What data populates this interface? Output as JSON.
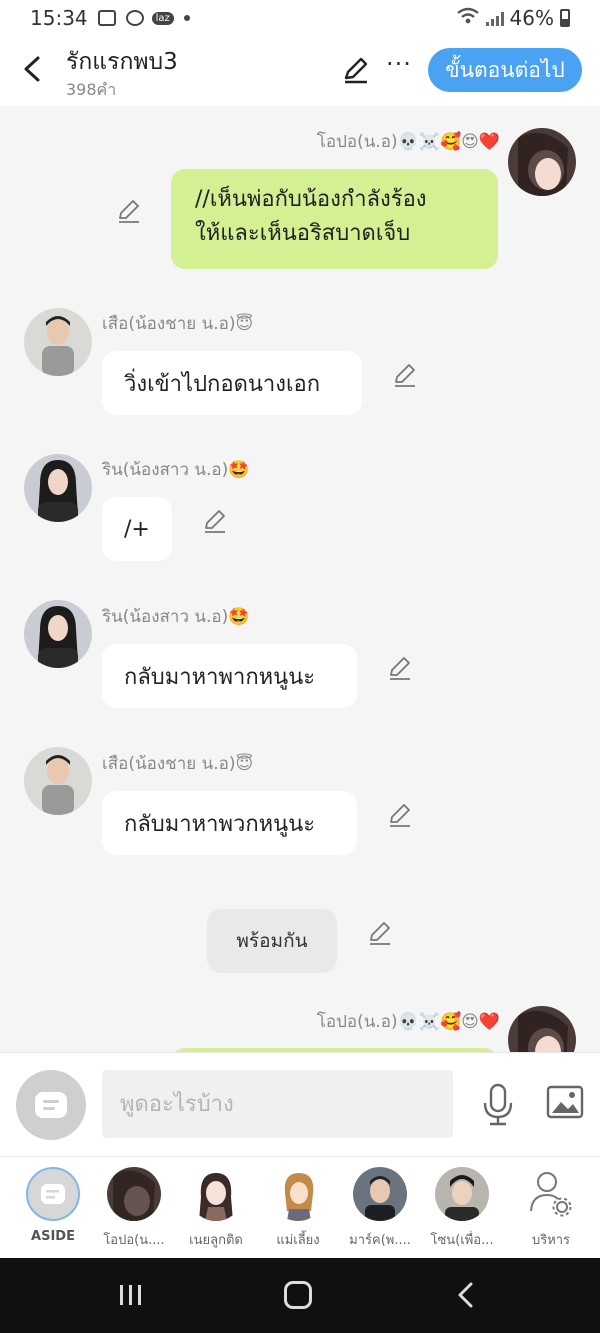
{
  "status": {
    "time": "15:34",
    "battery": "46%",
    "notification_icons": [
      "gallery-icon",
      "screen-record-icon",
      "lazada-icon"
    ],
    "laz_label": "laz"
  },
  "header": {
    "title": "รักแรกพบ3",
    "subtitle": "398คำ",
    "more": "···",
    "next_button": "ขั้นตอนต่อไป"
  },
  "messages": [
    {
      "speaker": "โอปอ(น.อ)💀☠️🥰😍❤️",
      "text": "//เห็นพ่อกับน้องกำลังร้องให้และเห็นอริสบาดเจ็บ",
      "line1": "//เห็นพ่อกับน้องกำลังร้อง",
      "line2": "ให้และเห็นอริสบาดเจ็บ",
      "side": "right"
    },
    {
      "speaker": "เสือ(น้องชาย น.อ)😇",
      "text": "วิ่งเข้าไปกอดนางเอก",
      "side": "left"
    },
    {
      "speaker": "ริน(น้องสาว น.อ)🤩",
      "text": "/+",
      "side": "left"
    },
    {
      "speaker": "ริน(น้องสาว น.อ)🤩",
      "text": "กลับมาหาพากหนูนะ",
      "side": "left"
    },
    {
      "speaker": "เสือ(น้องชาย น.อ)😇",
      "text": "กลับมาหาพวกหนูนะ",
      "side": "left"
    },
    {
      "speaker": "",
      "text": "พร้อมกัน",
      "side": "center"
    },
    {
      "speaker": "โอปอ(น.อ)💀☠️🥰😍❤️",
      "text": "",
      "side": "right"
    }
  ],
  "input": {
    "placeholder": "พูดอะไรบ้าง"
  },
  "characters": [
    {
      "label": "ASIDE"
    },
    {
      "label": "โอปอ(น...."
    },
    {
      "label": "เนยลูกติด"
    },
    {
      "label": "แม่เลี้ยง"
    },
    {
      "label": "มาร์ค(พ...."
    },
    {
      "label": "โซน(เพื่อ..."
    },
    {
      "label": "บริหาร"
    }
  ],
  "colors": {
    "accent": "#4aa3f2",
    "bubble_self": "#d3f093",
    "bubble_other": "#ffffff",
    "narration_bubble": "#e9e9e9"
  }
}
